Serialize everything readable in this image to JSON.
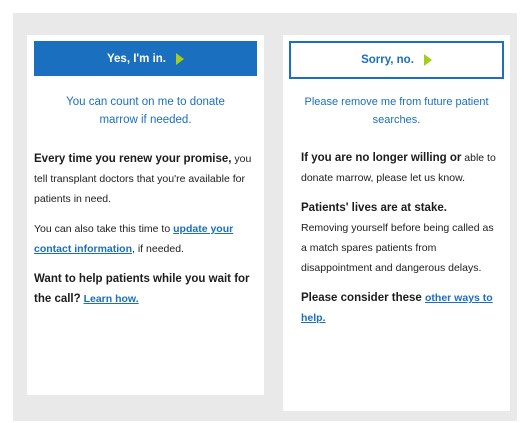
{
  "left_card": {
    "button_label": "Yes, I'm in.",
    "tagline": "You can count on me to donate marrow if needed.",
    "p1_lead": "Every time you renew your promise,",
    "p1_rest": " you tell transplant doctors that you're available for patients in need.",
    "p2_before": "You can also take this time to ",
    "p2_link": "update your contact information",
    "p2_after": ", if needed.",
    "p3_lead": "Want to help patients while you wait for the call?",
    "p3_link": "Learn how."
  },
  "right_card": {
    "button_label": "Sorry, no.",
    "tagline": "Please remove me from future patient searches.",
    "p1_lead": "If you are no longer willing or",
    "p1_rest": " able to donate marrow, please let us know.",
    "p2_lead": "Patients' lives are at stake.",
    "p2_rest": " Removing yourself before being called as a match spares patients from disappointment and dangerous delays.",
    "p3_lead": "Please consider these ",
    "p3_link": "other ways to help."
  },
  "colors": {
    "primary_blue": "#1a6fbe",
    "arrow_green": "#a6cc1c",
    "frame_gray": "#e9e9ea"
  },
  "icons": {
    "button_arrow": "arrow-right-icon"
  }
}
